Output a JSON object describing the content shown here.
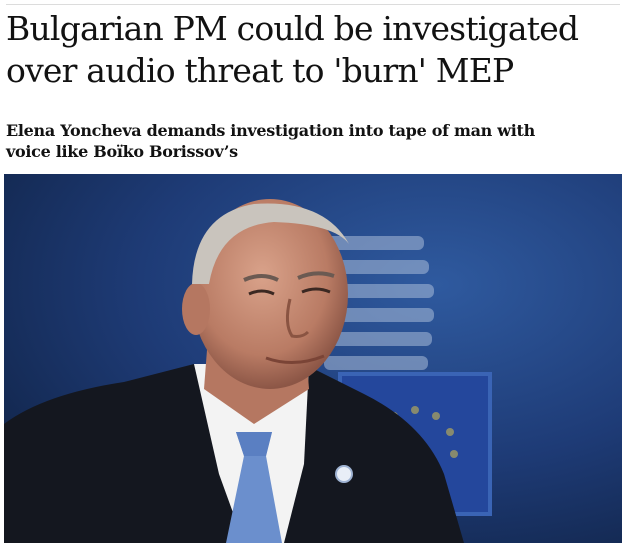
{
  "article": {
    "headline": "Bulgarian PM could be investigated over audio threat to 'burn' MEP",
    "standfirst": "Elena Yoncheva demands investigation into tape of man with voice like Boïko Borissov’s"
  },
  "photo": {
    "subject": "man in dark suit, white shirt and blue tie in front of EU flag emblem",
    "colors": {
      "background": "#1f3c76",
      "flag": "#23449a",
      "suit": "#13161e",
      "tie": "#6f93d0",
      "shirt": "#f4f4f4",
      "skin": "#c88e76"
    }
  }
}
